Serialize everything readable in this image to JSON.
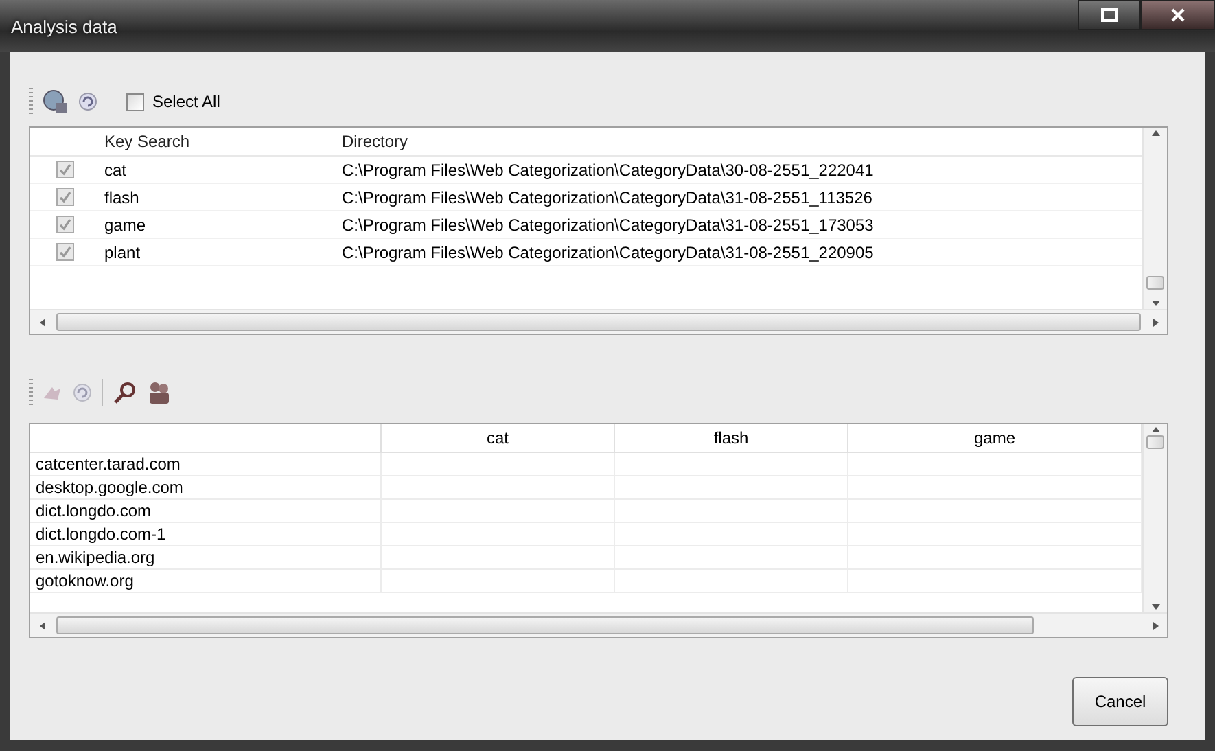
{
  "window": {
    "title": "Analysis data"
  },
  "top_toolbar": {
    "select_all": {
      "label": "Select All",
      "checked": false
    }
  },
  "keyword_table": {
    "columns": [
      "Key Search",
      "Directory"
    ],
    "rows": [
      {
        "checked": true,
        "key": "cat",
        "directory": "C:\\Program Files\\Web Categorization\\CategoryData\\30-08-2551_222041"
      },
      {
        "checked": true,
        "key": "flash",
        "directory": "C:\\Program Files\\Web Categorization\\CategoryData\\31-08-2551_113526"
      },
      {
        "checked": true,
        "key": "game",
        "directory": "C:\\Program Files\\Web Categorization\\CategoryData\\31-08-2551_173053"
      },
      {
        "checked": true,
        "key": "plant",
        "directory": "C:\\Program Files\\Web Categorization\\CategoryData\\31-08-2551_220905"
      }
    ]
  },
  "result_table": {
    "columns": [
      "cat",
      "flash",
      "game"
    ],
    "rows": [
      "catcenter.tarad.com",
      "desktop.google.com",
      "dict.longdo.com",
      "dict.longdo.com-1",
      "en.wikipedia.org",
      "gotoknow.org"
    ]
  },
  "buttons": [
    "Cancel"
  ]
}
